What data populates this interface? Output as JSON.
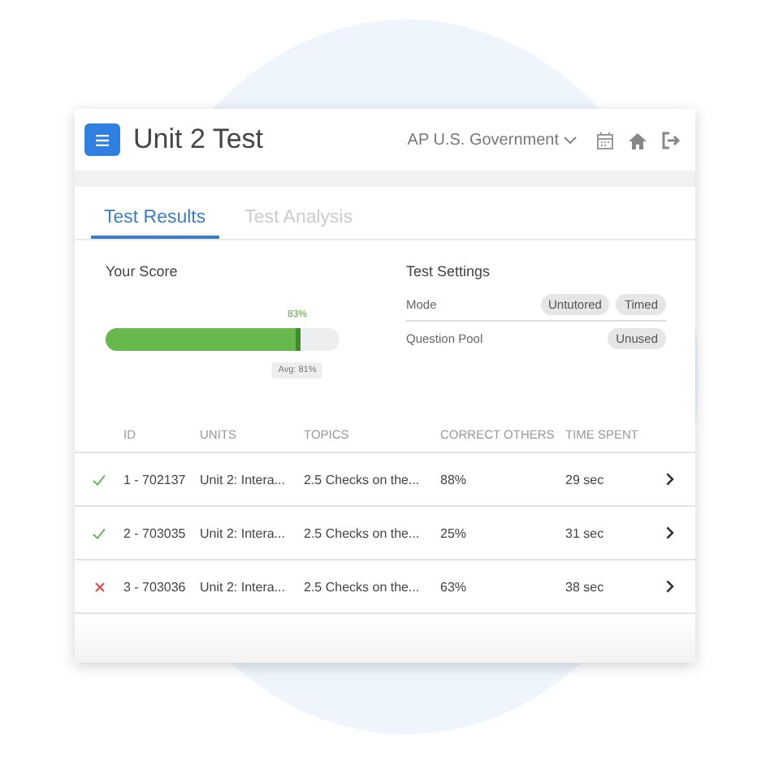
{
  "header": {
    "title": "Unit 2 Test",
    "course": "AP U.S. Government"
  },
  "tabs": [
    {
      "label": "Test Results",
      "selected": true
    },
    {
      "label": "Test Analysis",
      "selected": false
    }
  ],
  "score": {
    "heading": "Your Score",
    "level": 0.83,
    "reading": "83%",
    "average": "Avg: 81%"
  },
  "settings": {
    "heading": "Test Settings",
    "rows": [
      {
        "label": "Mode",
        "tags": [
          "Untutored",
          "Timed"
        ]
      },
      {
        "label": "Question Pool",
        "tags": [
          "Unused"
        ]
      }
    ]
  },
  "table": {
    "columns": [
      "ID",
      "UNITS",
      "TOPICS",
      "CORRECT OTHERS",
      "TIME SPENT"
    ],
    "rows": [
      {
        "correct": true,
        "cells": [
          "1 - 702137",
          "Unit 2: Intera...",
          "2.5 Checks on the...",
          "88%",
          "29 sec"
        ]
      },
      {
        "correct": true,
        "cells": [
          "2 - 703035",
          "Unit 2: Intera...",
          "2.5 Checks on the...",
          "25%",
          "31 sec"
        ]
      },
      {
        "correct": false,
        "cells": [
          "3 - 703036",
          "Unit 2: Intera...",
          "2.5 Checks on the...",
          "63%",
          "38 sec"
        ]
      }
    ]
  }
}
